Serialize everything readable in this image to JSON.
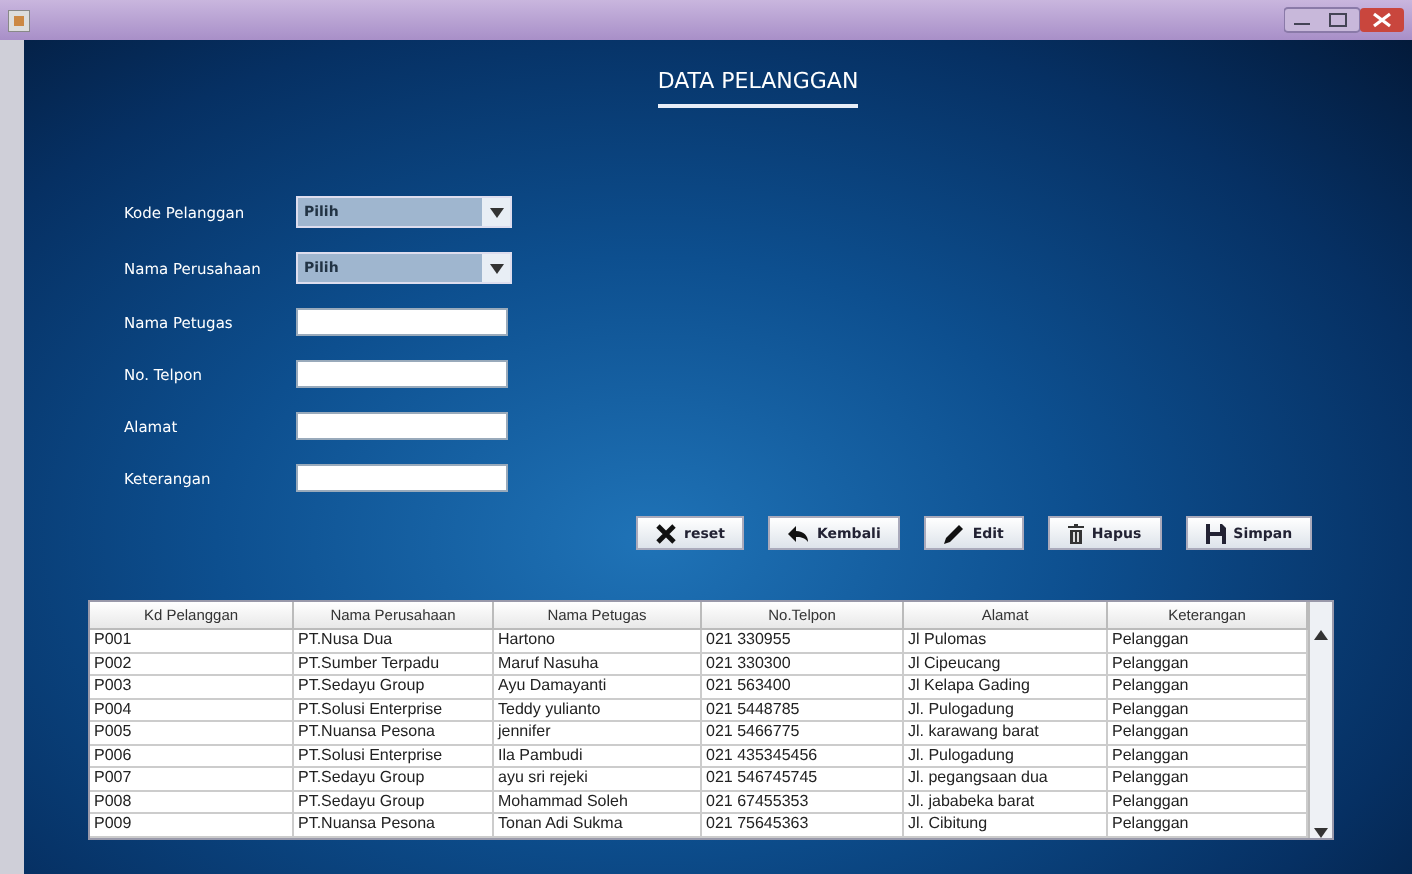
{
  "title": "DATA PELANGGAN",
  "form": [
    {
      "label": "Kode Pelanggan",
      "kind": "dropdown",
      "value": "Pilih"
    },
    {
      "label": "Nama Perusahaan",
      "kind": "dropdown",
      "value": "Pilih"
    },
    {
      "label": "Nama Petugas",
      "kind": "text"
    },
    {
      "label": "No. Telpon",
      "kind": "text"
    },
    {
      "label": "Alamat",
      "kind": "text"
    },
    {
      "label": "Keterangan",
      "kind": "text"
    }
  ],
  "buttons": [
    "reset",
    "Kembali",
    "Edit",
    "Hapus",
    "Simpan"
  ],
  "table": {
    "columns": [
      "Kd Pelanggan",
      "Nama Perusahaan",
      "Nama Petugas",
      "No.Telpon",
      "Alamat",
      "Keterangan"
    ],
    "rows": [
      [
        "P001",
        "PT.Nusa Dua",
        "Hartono",
        "021 330955",
        "Jl Pulomas",
        "Pelanggan"
      ],
      [
        "P002",
        "PT.Sumber Terpadu",
        "Maruf Nasuha",
        "021 330300",
        "Jl Cipeucang",
        "Pelanggan"
      ],
      [
        "P003",
        "PT.Sedayu Group",
        "Ayu Damayanti",
        "021 563400",
        "Jl Kelapa Gading",
        "Pelanggan"
      ],
      [
        "P004",
        "PT.Solusi Enterprise",
        "Teddy yulianto",
        "021 5448785",
        "Jl. Pulogadung",
        "Pelanggan"
      ],
      [
        "P005",
        "PT.Nuansa Pesona",
        "jennifer",
        "021 5466775",
        "Jl. karawang barat",
        "Pelanggan"
      ],
      [
        "P006",
        "PT.Solusi Enterprise",
        "Ila Pambudi",
        "021 435345456",
        "Jl. Pulogadung",
        "Pelanggan"
      ],
      [
        "P007",
        "PT.Sedayu Group",
        "ayu sri rejeki",
        "021 546745745",
        "Jl. pegangsaan dua",
        "Pelanggan"
      ],
      [
        "P008",
        "PT.Sedayu Group",
        "Mohammad Soleh",
        "021 67455353",
        "Jl. jababeka barat",
        "Pelanggan"
      ],
      [
        "P009",
        "PT.Nuansa Pesona",
        "Tonan Adi Sukma",
        "021 75645363",
        "Jl. Cibitung",
        "Pelanggan"
      ]
    ]
  }
}
